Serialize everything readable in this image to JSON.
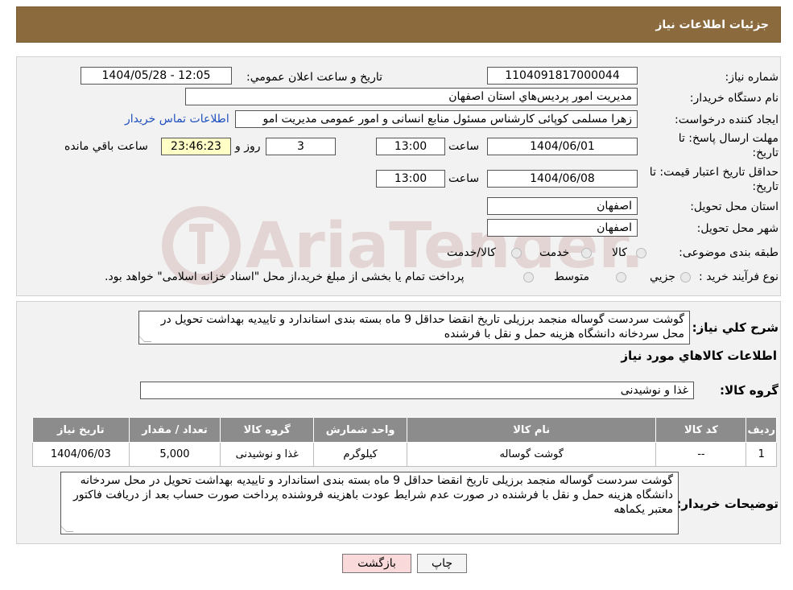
{
  "header": {
    "title": "جزئیات اطلاعات نیاز"
  },
  "form": {
    "need_number_label": "شماره نیاز:",
    "need_number": "1104091817000044",
    "announce_label": "تاریخ و ساعت اعلان عمومي:",
    "announce_value": "1404/05/28 - 12:05",
    "buyer_org_label": "نام دستگاه خريدار:",
    "buyer_org": "مديريت امور پرديس‌هاي استان اصفهان",
    "creator_label": "ايجاد كننده درخواست:",
    "creator": "زهرا مسلمی کوپائی کارشناس مسئول منابع انسانی و امور عمومی مدیریت امو",
    "contact_link": "اطلاعات تماس خريدار",
    "deadline_label_1": "مهلت ارسال پاسخ: تا",
    "deadline_label_2": "تاريخ:",
    "deadline_date": "1404/06/01",
    "time_label": "ساعت",
    "deadline_time": "13:00",
    "days_value": "3",
    "days_label": "روز و",
    "remaining_value": "23:46:23",
    "remaining_label": "ساعت باقي مانده",
    "validity_label_1": "حداقل تاريخ اعتبار قيمت: تا",
    "validity_label_2": "تاريخ:",
    "validity_date": "1404/06/08",
    "validity_time": "13:00",
    "province_label": "استان محل تحويل:",
    "province": "اصفهان",
    "city_label": "شهر محل تحويل:",
    "city": "اصفهان",
    "category_label": "طبقه بندی موضوعی:",
    "category_options": [
      "کالا",
      "خدمت",
      "کالا/خدمت"
    ],
    "process_label": "نوع فرآيند خريد :",
    "process_options": [
      "جزيي",
      "متوسط"
    ],
    "process_note": "پرداخت تمام يا بخشی از مبلغ خريد،از محل \"اسناد خزانه اسلامی\" خواهد بود."
  },
  "watermark": {
    "text": "AriaTender.neT"
  },
  "details": {
    "summary_label": "شرح كلي نياز:",
    "summary": "گوشت سردست گوساله منجمد برزیلی تاریخ انقضا حداقل 9 ماه بسته بندی استاندارد و تاییدیه بهداشت تحویل در محل سردخانه دانشگاه هزینه حمل و نقل با فرشنده",
    "goods_info_title": "اطلاعات كالاهاي مورد نياز",
    "goods_group_label": "گروه كالا:",
    "goods_group": "غذا و نوشیدنی"
  },
  "table": {
    "headers": [
      "رديف",
      "كد كالا",
      "نام كالا",
      "واحد شمارش",
      "گروه كالا",
      "تعداد / مقدار",
      "تاريخ نياز"
    ],
    "rows": [
      [
        "1",
        "--",
        "گوشت گوساله",
        "کیلوگرم",
        "غذا و نوشیدنی",
        "5,000",
        "1404/06/03"
      ]
    ]
  },
  "buyer_notes": {
    "label": "توضيحات خريدار:",
    "text": "گوشت سردست گوساله منجمد برزیلی تاریخ انقضا حداقل 9 ماه بسته بندی استاندارد و تاییدیه بهداشت تحویل در محل سردخانه دانشگاه هزینه حمل و نقل با فرشنده در صورت عدم شرایط عودت باهزینه فروشنده پرداخت صورت حساب بعد از دریافت فاکتور معتبر یکماهه"
  },
  "buttons": {
    "print": "چاپ",
    "back": "بازگشت"
  },
  "colors": {
    "header": "#8b6a3e",
    "table_header": "#8c8c8c",
    "back_button": "#f9d9d9",
    "remaining_bg": "#ffffc6"
  }
}
